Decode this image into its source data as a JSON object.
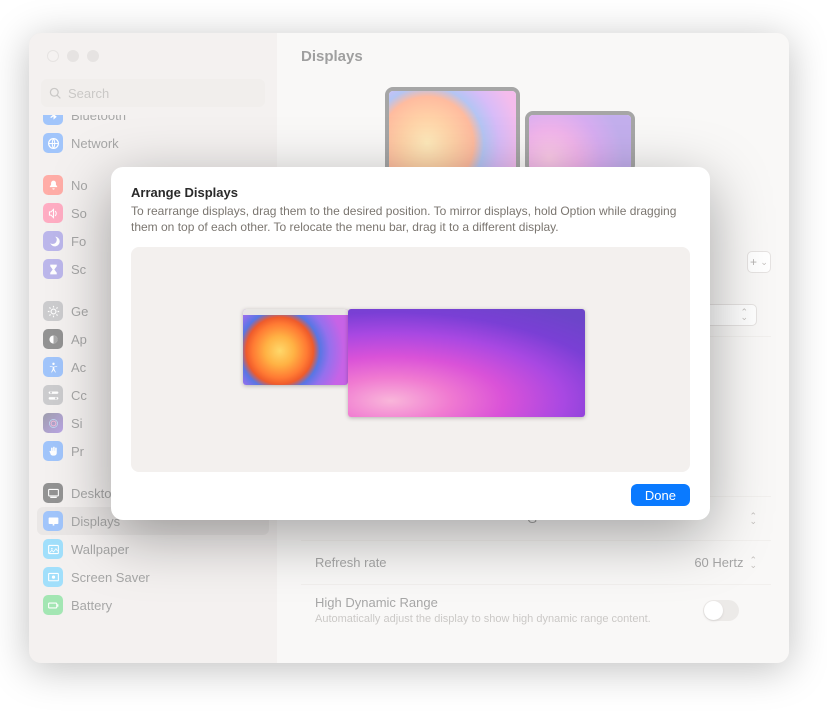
{
  "window": {
    "title": "Displays",
    "search_placeholder": "Search"
  },
  "sidebar": {
    "items": [
      {
        "label": "Bluetooth",
        "color": "#2f7ef6",
        "icon": "bluetooth"
      },
      {
        "label": "Network",
        "color": "#2f7ef6",
        "icon": "network"
      }
    ],
    "group2": [
      {
        "label": "Notifications",
        "short": "No",
        "color": "#ff4a3d",
        "icon": "bell"
      },
      {
        "label": "Sound",
        "short": "So",
        "color": "#ff4a7a",
        "icon": "sound"
      },
      {
        "label": "Focus",
        "short": "Fo",
        "color": "#6b5fd3",
        "icon": "moon"
      },
      {
        "label": "Screen Time",
        "short": "Sc",
        "color": "#6b5fd3",
        "icon": "hourglass"
      }
    ],
    "group3": [
      {
        "label": "General",
        "short": "Ge",
        "color": "#8e8e93",
        "icon": "gear"
      },
      {
        "label": "Appearance",
        "short": "Ap",
        "color": "#111",
        "icon": "appearance"
      },
      {
        "label": "Accessibility",
        "short": "Ac",
        "color": "#2f7ef6",
        "icon": "accessibility"
      },
      {
        "label": "Control Center",
        "short": "Cc",
        "color": "#8e8e93",
        "icon": "switches"
      },
      {
        "label": "Siri & Spotlight",
        "short": "Si",
        "color": "#4a33c8",
        "icon": "siri"
      },
      {
        "label": "Privacy & Security",
        "short": "Pr",
        "color": "#2f7ef6",
        "icon": "hand"
      }
    ],
    "group4": [
      {
        "label": "Desktop & Dock",
        "color": "#111",
        "icon": "dock"
      },
      {
        "label": "Displays",
        "color": "#2f7ef6",
        "icon": "display",
        "selected": true
      },
      {
        "label": "Wallpaper",
        "color": "#2fb8f6",
        "icon": "wallpaper"
      },
      {
        "label": "Screen Saver",
        "color": "#2fb8f6",
        "icon": "screensaver"
      },
      {
        "label": "Battery",
        "color": "#33c758",
        "icon": "battery"
      }
    ]
  },
  "settings": {
    "rows": [
      {
        "label": "",
        "value": ""
      },
      {
        "label": "",
        "value": ""
      }
    ],
    "refresh_label": "Refresh rate",
    "refresh_value": "60 Hertz",
    "hdr_label": "High Dynamic Range",
    "hdr_sub": "Automatically adjust the display to show high dynamic range content.",
    "add_hint": "+",
    "style_suffix": "G"
  },
  "modal": {
    "title": "Arrange Displays",
    "description": "To rearrange displays, drag them to the desired position. To mirror displays, hold Option while dragging them on top of each other. To relocate the menu bar, drag it to a different display.",
    "done": "Done"
  }
}
